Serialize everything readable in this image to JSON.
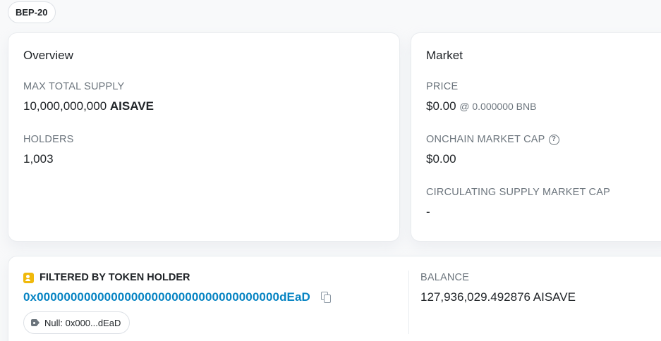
{
  "token_standard": "BEP-20",
  "overview": {
    "title": "Overview",
    "max_supply_label": "MAX TOTAL SUPPLY",
    "max_supply_amount": "10,000,000,000",
    "max_supply_symbol": "AISAVE",
    "holders_label": "HOLDERS",
    "holders_value": "1,003"
  },
  "market": {
    "title": "Market",
    "price_label": "PRICE",
    "price_value": "$0.00",
    "price_bnb": "@ 0.000000 BNB",
    "onchain_cap_label": "ONCHAIN MARKET CAP",
    "onchain_cap_value": "$0.00",
    "circ_cap_label": "CIRCULATING SUPPLY MARKET CAP",
    "circ_cap_value": "-"
  },
  "filter": {
    "heading": "FILTERED BY TOKEN HOLDER",
    "address": "0x000000000000000000000000000000000000dEaD",
    "name_tag": "Null: 0x000...dEaD",
    "balance_label": "BALANCE",
    "balance_value": "127,936,029.492876 AISAVE"
  },
  "icons": {
    "help": "question-circle-icon",
    "contact": "contact-card-icon",
    "copy": "copy-icon",
    "tag": "tag-icon"
  },
  "colors": {
    "link": "#0784c3",
    "accent": "#f0b90b",
    "muted": "#6c757d"
  }
}
